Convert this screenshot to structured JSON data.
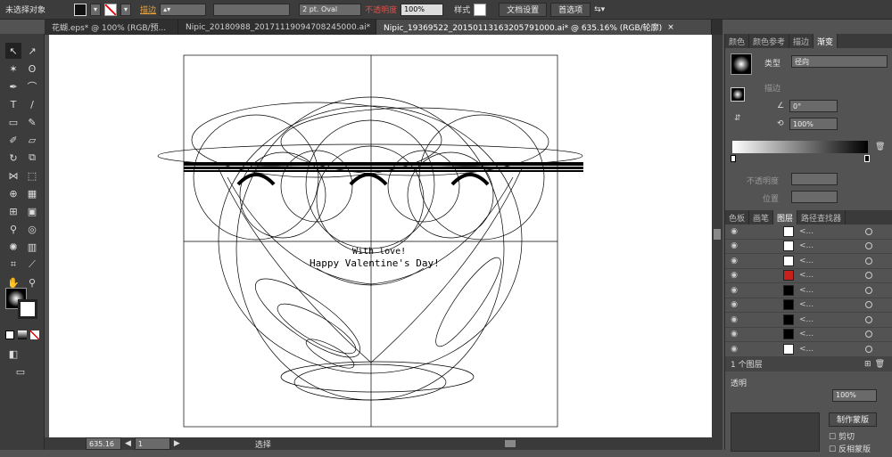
{
  "control": {
    "selection": "未选择对象",
    "stroke_label": "描边",
    "stroke_style": "2 pt. Oval",
    "opacity_label": "不透明度",
    "opacity": "100%",
    "style_label": "样式",
    "doc_setup": "文档设置",
    "prefs": "首选项"
  },
  "tabs": [
    "花蝴.eps* @ 100% (RGB/预...",
    "Nipic_20180988_20171119094708245000.ai*",
    "Nipic_19369522_20150113163205791000.ai* @ 635.16% (RGB/轮廓)"
  ],
  "art": {
    "text1": "With love!",
    "text2": "Happy Valentine's Day!"
  },
  "status": {
    "zoom": "635.16",
    "page": "1",
    "tool": "选择"
  },
  "panel": {
    "tabs1": [
      "颜色",
      "颜色参考",
      "描边",
      "渐变"
    ],
    "type_label": "类型",
    "type_value": "径向",
    "stroke_label": "描边",
    "angle": "0°",
    "ratio": "100%",
    "opacity_label": "不透明度",
    "position_label": "位置",
    "tabs2": [
      "色板",
      "画笔",
      "图层",
      "路径查找器"
    ],
    "layer_count": "1 个图层",
    "transp": "透明",
    "opacity2": "100%",
    "make_mask": "制作蒙版",
    "clip": "剪切",
    "invert": "反相蒙版"
  },
  "layers": [
    "<...",
    "<...",
    "<...",
    "<...",
    "<...",
    "<...",
    "<...",
    "<...",
    "<..."
  ],
  "colors": {
    "accent": "#e8a33c",
    "heart": "#c8201c"
  }
}
